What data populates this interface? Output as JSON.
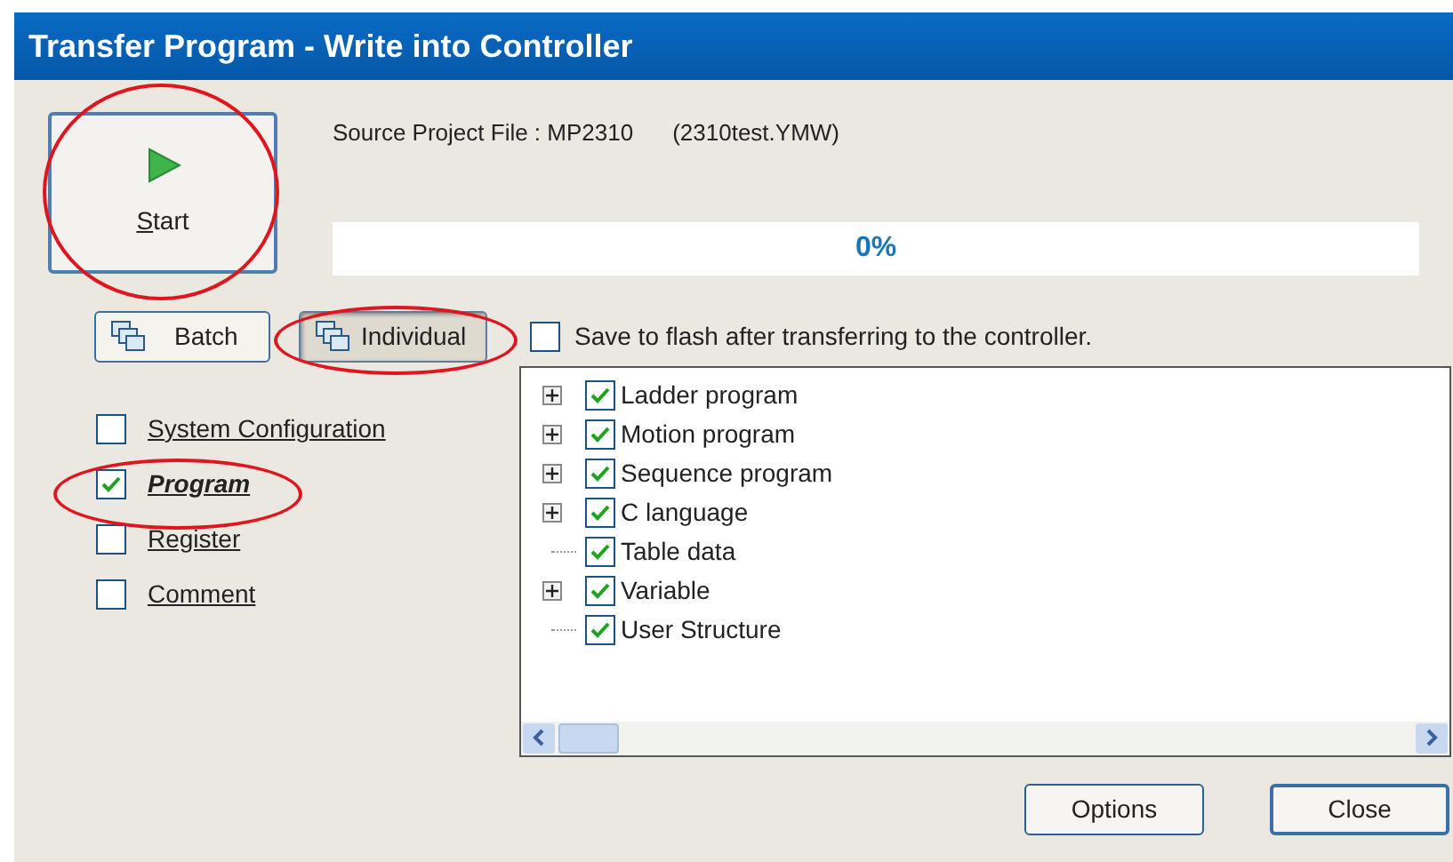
{
  "window": {
    "title": "Transfer Program - Write into Controller"
  },
  "start_button": {
    "label": "Start"
  },
  "source": {
    "text": "Source Project File : MP2310",
    "file": "(2310test.YMW)"
  },
  "progress": {
    "level": 0,
    "reading": "0%"
  },
  "mode_buttons": [
    {
      "label": "Batch",
      "selected": false
    },
    {
      "label": "Individual",
      "selected": true
    }
  ],
  "save_to_flash": {
    "label": "Save to flash after transferring to the controller.",
    "checked": false
  },
  "categories": [
    {
      "label": "System Configuration",
      "checked": false
    },
    {
      "label": "Program",
      "checked": true
    },
    {
      "label": "Register",
      "checked": false
    },
    {
      "label": "Comment",
      "checked": false
    }
  ],
  "tree": [
    {
      "label": "Ladder program",
      "checked": true,
      "expandable": true
    },
    {
      "label": "Motion program",
      "checked": true,
      "expandable": true
    },
    {
      "label": "Sequence program",
      "checked": true,
      "expandable": true
    },
    {
      "label": "C language",
      "checked": true,
      "expandable": true
    },
    {
      "label": "Table data",
      "checked": true,
      "expandable": false
    },
    {
      "label": "Variable",
      "checked": true,
      "expandable": true
    },
    {
      "label": "User Structure",
      "checked": true,
      "expandable": false
    }
  ],
  "buttons": [
    {
      "label": "Options"
    },
    {
      "label": "Close"
    }
  ]
}
